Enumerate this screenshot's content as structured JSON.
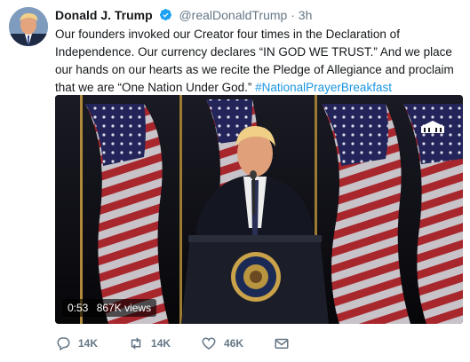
{
  "tweet": {
    "author_name": "Donald J. Trump",
    "handle": "@realDonaldTrump",
    "separator": "·",
    "time": "3h",
    "text_main": "Our founders invoked our Creator four times in the Declaration of Independence. Our currency declares “IN GOD WE TRUST.” And we place our hands on our hearts as we recite the Pledge of Allegiance and proclaim that we are “One Nation Under God.”",
    "hashtag": "#NationalPrayerBreakfast"
  },
  "video": {
    "duration": "0:53",
    "views": "867K views"
  },
  "actions": {
    "reply_count": "14K",
    "retweet_count": "14K",
    "like_count": "46K"
  },
  "icons": {
    "verified": "verified-badge-icon",
    "reply": "reply-icon",
    "retweet": "retweet-icon",
    "like": "heart-icon",
    "message": "envelope-icon"
  },
  "colors": {
    "link": "#1b95e0",
    "verified": "#1da1f2",
    "muted": "#657786",
    "text": "#14171a"
  }
}
